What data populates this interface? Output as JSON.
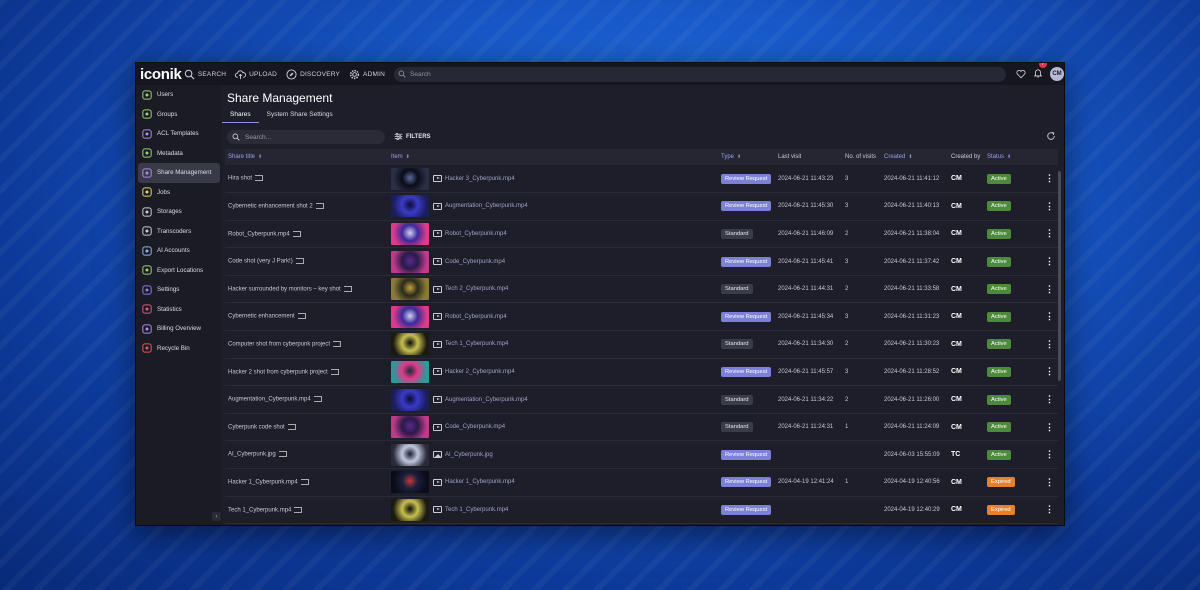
{
  "app": {
    "logo": "iconik",
    "nav": [
      {
        "label": "SEARCH",
        "icon": "search-icon"
      },
      {
        "label": "UPLOAD",
        "icon": "upload-icon"
      },
      {
        "label": "DISCOVERY",
        "icon": "compass-icon"
      },
      {
        "label": "ADMIN",
        "icon": "gear-icon"
      }
    ],
    "search_placeholder": "Search",
    "notification_count": "7",
    "avatar_initials": "CM"
  },
  "sidebar": {
    "items": [
      {
        "label": "Users",
        "icon": "user-icon",
        "color": "#9bd36b"
      },
      {
        "label": "Groups",
        "icon": "group-icon",
        "color": "#9bd36b"
      },
      {
        "label": "ACL Templates",
        "icon": "acl-template-icon",
        "color": "#b08be8"
      },
      {
        "label": "Metadata",
        "icon": "metadata-icon",
        "color": "#9bd36b"
      },
      {
        "label": "Share Management",
        "icon": "share-icon",
        "color": "#b08be8",
        "active": true
      },
      {
        "label": "Jobs",
        "icon": "lightning-icon",
        "color": "#e6d65a"
      },
      {
        "label": "Storages",
        "icon": "storage-icon",
        "color": "#c9cbd7"
      },
      {
        "label": "Transcoders",
        "icon": "transcoder-icon",
        "color": "#c9cbd7"
      },
      {
        "label": "AI Accounts",
        "icon": "ai-account-icon",
        "color": "#8ab4f8"
      },
      {
        "label": "Export Locations",
        "icon": "export-icon",
        "color": "#9bd36b"
      },
      {
        "label": "Settings",
        "icon": "gear-icon",
        "color": "#8a7bf0"
      },
      {
        "label": "Statistics",
        "icon": "statistics-icon",
        "color": "#e05a7a"
      },
      {
        "label": "Billing Overview",
        "icon": "billing-icon",
        "color": "#b08be8"
      },
      {
        "label": "Recycle Bin",
        "icon": "trash-icon",
        "color": "#e05a5a"
      }
    ]
  },
  "page": {
    "title": "Share Management",
    "tabs": [
      {
        "label": "Shares",
        "active": true
      },
      {
        "label": "System Share Settings",
        "active": false
      }
    ],
    "search_placeholder": "Search...",
    "filters_label": "FILTERS"
  },
  "table": {
    "columns": [
      "Share title",
      "Item",
      "Type",
      "Last visit",
      "No. of visits",
      "Created",
      "Created by",
      "Status"
    ],
    "rows": [
      {
        "title": "Hira shot",
        "item": "Hacker 3_Cyberpunk.mp4",
        "file": "video",
        "type": "Review Request",
        "last_visit": "2024-06-21 11:43:23",
        "visits": "3",
        "created": "2024-06-21 11:41:12",
        "by": "CM",
        "status": "Active",
        "thumb": [
          "#2a2f46",
          "#0a0c18",
          "#5a6a99"
        ]
      },
      {
        "title": "Cybernetic enhancement shot 2",
        "item": "Augmentation_Cyberpunk.mp4",
        "file": "video",
        "type": "Review Request",
        "last_visit": "2024-06-21 11:45:30",
        "visits": "3",
        "created": "2024-06-21 11:40:13",
        "by": "CM",
        "status": "Active",
        "thumb": [
          "#1a1e5a",
          "#3a3ac8",
          "#0a0c30"
        ]
      },
      {
        "title": "Robot_Cyberpunk.mp4",
        "item": "Robot_Cyberpunk.mp4",
        "file": "video",
        "type": "Standard",
        "last_visit": "2024-06-21 11:46:09",
        "visits": "2",
        "created": "2024-06-21 11:38:04",
        "by": "CM",
        "status": "Active",
        "thumb": [
          "#e03a8a",
          "#3a2a9a",
          "#d4d0f0"
        ]
      },
      {
        "title": "Code shot (very J Park!)",
        "item": "Code_Cyberpunk.mp4",
        "file": "video",
        "type": "Review Request",
        "last_visit": "2024-06-21 11:45:41",
        "visits": "3",
        "created": "2024-06-21 11:37:42",
        "by": "CM",
        "status": "Active",
        "thumb": [
          "#c03a8a",
          "#2a1a4a",
          "#5a2a8a"
        ]
      },
      {
        "title": "Hacker surrounded by monitors – key shot",
        "item": "Tech 2_Cyberpunk.mp4",
        "file": "video",
        "type": "Standard",
        "last_visit": "2024-06-21 11:44:31",
        "visits": "2",
        "created": "2024-06-21 11:33:58",
        "by": "CM",
        "status": "Active",
        "thumb": [
          "#8a7a3a",
          "#2a2a1a",
          "#c0a040"
        ]
      },
      {
        "title": "Cybernetic enhancement",
        "item": "Robot_Cyberpunk.mp4",
        "file": "video",
        "type": "Review Request",
        "last_visit": "2024-06-21 11:45:34",
        "visits": "3",
        "created": "2024-06-21 11:31:23",
        "by": "CM",
        "status": "Active",
        "thumb": [
          "#e03a8a",
          "#3a2a9a",
          "#d4d0f0"
        ]
      },
      {
        "title": "Computer shot from cyberpunk project",
        "item": "Tech 1_Cyberpunk.mp4",
        "file": "video",
        "type": "Standard",
        "last_visit": "2024-06-21 11:34:30",
        "visits": "2",
        "created": "2024-06-21 11:30:23",
        "by": "CM",
        "status": "Active",
        "thumb": [
          "#1a1a10",
          "#c8c050",
          "#0a0a08"
        ]
      },
      {
        "title": "Hacker 2 shot from cyberpunk project",
        "item": "Hacker 2_Cyberpunk.mp4",
        "file": "video",
        "type": "Review Request",
        "last_visit": "2024-06-21 11:45:57",
        "visits": "3",
        "created": "2024-06-21 11:28:52",
        "by": "CM",
        "status": "Active",
        "thumb": [
          "#2a9a9a",
          "#e03a8a",
          "#1a2a3a"
        ]
      },
      {
        "title": "Augmentation_Cyberpunk.mp4",
        "item": "Augmentation_Cyberpunk.mp4",
        "file": "video",
        "type": "Standard",
        "last_visit": "2024-06-21 11:34:22",
        "visits": "2",
        "created": "2024-06-21 11:26:00",
        "by": "CM",
        "status": "Active",
        "thumb": [
          "#1a1e5a",
          "#3a3ac8",
          "#0a0c30"
        ]
      },
      {
        "title": "Cyberpunk code shot",
        "item": "Code_Cyberpunk.mp4",
        "file": "video",
        "type": "Standard",
        "last_visit": "2024-06-21 11:24:31",
        "visits": "1",
        "created": "2024-06-21 11:24:09",
        "by": "CM",
        "status": "Active",
        "thumb": [
          "#c03a8a",
          "#2a1a4a",
          "#5a2a8a"
        ]
      },
      {
        "title": "AI_Cyberpunk.jpg",
        "item": "AI_Cyberpunk.jpg",
        "file": "image",
        "type": "Review Request",
        "last_visit": "",
        "visits": "",
        "created": "2024-06-03 15:55:09",
        "by": "TC",
        "status": "Active",
        "thumb": [
          "#2a2a3a",
          "#c0c8e0",
          "#1a1a2a"
        ]
      },
      {
        "title": "Hacker 1_Cyberpunk.mp4",
        "item": "Hacker 1_Cyberpunk.mp4",
        "file": "video",
        "type": "Review Request",
        "last_visit": "2024-04-19 12:41:24",
        "visits": "1",
        "created": "2024-04-19 12:40:56",
        "by": "CM",
        "status": "Expired",
        "thumb": [
          "#0a0c1a",
          "#1a1e3a",
          "#c03a3a"
        ]
      },
      {
        "title": "Tech 1_Cyberpunk.mp4",
        "item": "Tech 1_Cyberpunk.mp4",
        "file": "video",
        "type": "Review Request",
        "last_visit": "",
        "visits": "",
        "created": "2024-04-19 12:40:29",
        "by": "CM",
        "status": "Expired",
        "thumb": [
          "#1a1a10",
          "#c8c050",
          "#0a0a08"
        ]
      }
    ]
  }
}
